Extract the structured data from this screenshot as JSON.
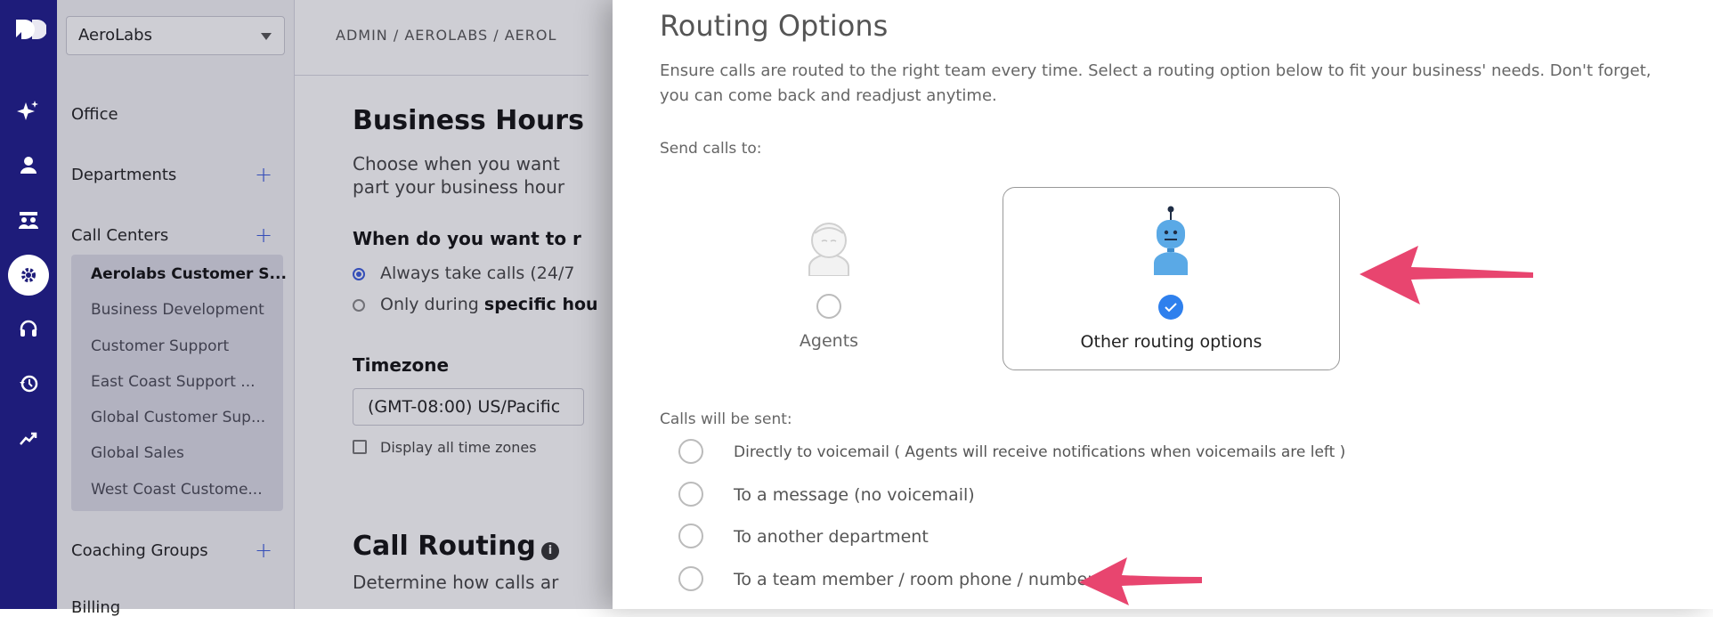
{
  "rail": {
    "logo_icon": "dialpad-logo-icon",
    "icons": [
      "sparkle-icon",
      "person-icon",
      "contact-center-icon",
      "settings-icon",
      "headset-icon",
      "history-icon",
      "analytics-icon"
    ],
    "active_index": 3,
    "bg": "#1e1c7a"
  },
  "sidebar": {
    "org_select": "AeroLabs",
    "office": "Office",
    "departments": "Departments",
    "call_centers": "Call Centers",
    "call_center_items": [
      "Aerolabs Customer S...",
      "Business Development",
      "Customer Support",
      "East Coast Support ...",
      "Global Customer Sup...",
      "Global Sales",
      "West Coast Custome..."
    ],
    "coaching_groups": "Coaching Groups",
    "billing": "Billing",
    "add": "+"
  },
  "main": {
    "breadcrumb": "ADMIN / AEROLABS / AEROL",
    "business_hours_title": "Business Hours",
    "bh_desc_1": "Choose when you want",
    "bh_desc_2": "part your business hour",
    "when_question": "When do you want to r",
    "radio_always": "Always take calls (24/7",
    "radio_only_prefix": "Only during ",
    "radio_only_bold": "specific hou",
    "timezone_label": "Timezone",
    "timezone_value": "(GMT-08:00) US/Pacific",
    "display_all_tz": "Display all time zones",
    "call_routing_title": "Call Routing",
    "info": "i",
    "call_routing_desc": "Determine how calls ar"
  },
  "routing": {
    "title": "Routing Options",
    "description": "Ensure calls are routed to the right team every time. Select a routing option below to fit your business' needs. Don't forget, you can come back and readjust anytime.",
    "send_calls_to": "Send calls to:",
    "cards": [
      {
        "label": "Agents",
        "icon": "agent-avatar-icon",
        "selected": false
      },
      {
        "label": "Other routing options",
        "icon": "robot-icon",
        "selected": true
      }
    ],
    "calls_will_be_sent": "Calls will be sent:",
    "options": [
      "Directly to voicemail ( Agents will receive notifications when voicemails are left )",
      "To a message (no voicemail)",
      "To another department",
      "To a team member / room phone / number"
    ],
    "accent": "#2f80ed",
    "annotation_color": "#e8456f"
  }
}
